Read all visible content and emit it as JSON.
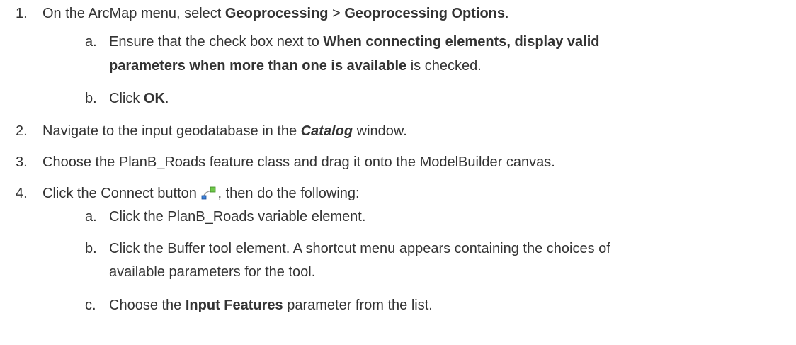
{
  "steps": [
    {
      "number": "1.",
      "prefix": "On the ArcMap menu, select ",
      "bold1": "Geoprocessing",
      "sep": " > ",
      "bold2": "Geoprocessing Options",
      "suffix": ".",
      "substeps": [
        {
          "letter": "a.",
          "prefix": "Ensure that the check box next to ",
          "bold_line1": "When connecting elements, display valid",
          "bold_line2": "parameters when more than one is available",
          "suffix": " is checked."
        },
        {
          "letter": "b.",
          "prefix": "Click ",
          "bold": "OK",
          "suffix": "."
        }
      ]
    },
    {
      "number": "2.",
      "prefix": "Navigate to the input geodatabase in the ",
      "bold_italic": "Catalog",
      "suffix": " window."
    },
    {
      "number": "3.",
      "text": "Choose the PlanB_Roads feature class and drag it onto the ModelBuilder canvas."
    },
    {
      "number": "4.",
      "prefix": "Click the Connect button ",
      "suffix": ", then do the following:",
      "icon": "connect-icon",
      "substeps": [
        {
          "letter": "a.",
          "text": "Click the PlanB_Roads variable element."
        },
        {
          "letter": "b.",
          "text_line1": "Click the Buffer tool element. A shortcut menu appears containing the choices of",
          "text_line2": "available parameters for the tool."
        },
        {
          "letter": "c.",
          "prefix": "Choose the ",
          "bold": "Input Features",
          "suffix": " parameter from the list."
        }
      ]
    }
  ]
}
